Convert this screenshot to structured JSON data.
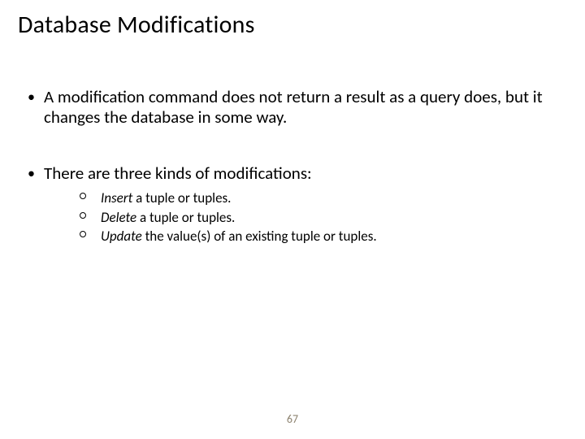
{
  "title": "Database Modifications",
  "bullets": {
    "b1": "A modification command does not return a result as a query does, but it changes the database in some way.",
    "b2": "There are three kinds of modifications:"
  },
  "sub": {
    "s1_word": "Insert",
    "s1_rest": "  a tuple or tuples.",
    "s2_word": "Delete",
    "s2_rest": " a tuple or tuples.",
    "s3_word": "Update",
    "s3_rest": " the value(s) of an existing tuple or tuples."
  },
  "page_number": "67"
}
